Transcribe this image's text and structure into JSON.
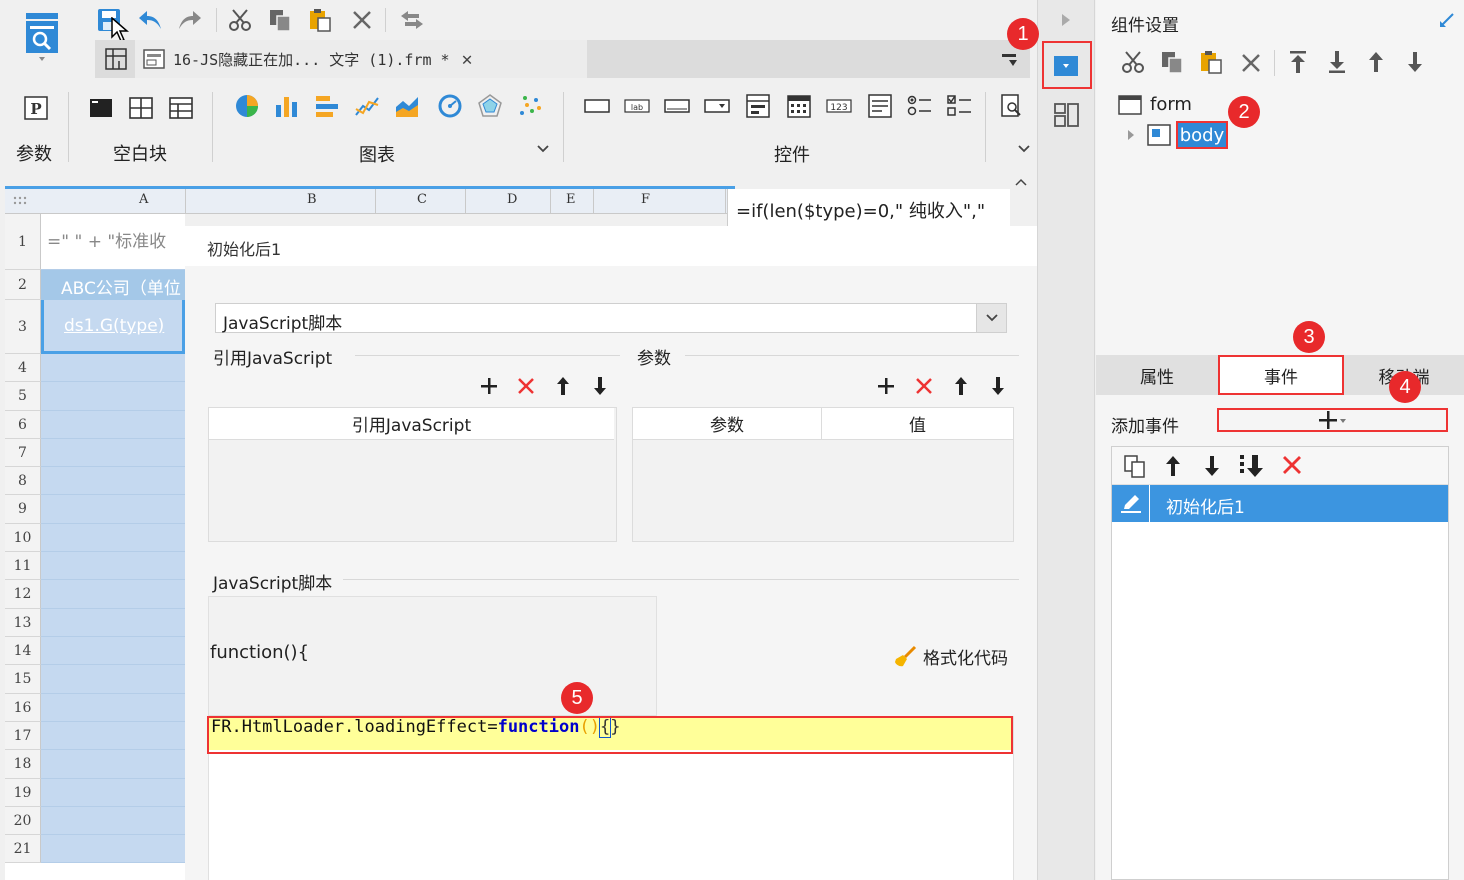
{
  "toolbar": {
    "file_tab_label": "16-JS隐藏正在加... 文字 (1).frm *",
    "groups": {
      "params_label": "参数",
      "blank_label": "空白块",
      "chart_label": "图表",
      "widget_label": "控件"
    }
  },
  "sheet": {
    "columns": [
      "A",
      "B",
      "C",
      "D",
      "E",
      "F"
    ],
    "formula_bar": "=if(len($type)=0,\"  纯收入\",\"",
    "rows": [
      "1",
      "2",
      "3",
      "4",
      "5",
      "6",
      "7",
      "8",
      "9",
      "10",
      "11",
      "12",
      "13",
      "14",
      "15",
      "16",
      "17",
      "18",
      "19",
      "20",
      "21"
    ],
    "cells": {
      "r1": "=\" \" + \"标准收",
      "r2_line1": "ABC公司（单位",
      "r2_line2": "）",
      "r3": "ds1.G(type)"
    }
  },
  "dialog": {
    "title": "初始化后1",
    "script_type": "JavaScript脚本",
    "ref_js_section": "引用JavaScript",
    "params_section": "参数",
    "ref_js_col": "引用JavaScript",
    "param_col": "参数",
    "value_col": "值",
    "script_section": "JavaScript脚本",
    "function_header": "function(){",
    "format_code": "格式化代码",
    "code": {
      "obj": "FR.HtmlLoader.loadingEffect=",
      "kw": "function",
      "parens": "()",
      "brace_open": "{",
      "brace_close": "}"
    }
  },
  "right": {
    "title": "组件设置",
    "tree": {
      "form": "form",
      "body": "body"
    },
    "tabs": [
      "属性",
      "事件",
      "移动端"
    ],
    "add_event_label": "添加事件",
    "events": [
      "初始化后1"
    ]
  },
  "badges": [
    "1",
    "2",
    "3",
    "4",
    "5"
  ],
  "colors": {
    "accent_blue": "#2f89d6",
    "highlight_red": "#e33333",
    "selected_row": "#3c95e0",
    "code_bg": "#ffff99"
  }
}
